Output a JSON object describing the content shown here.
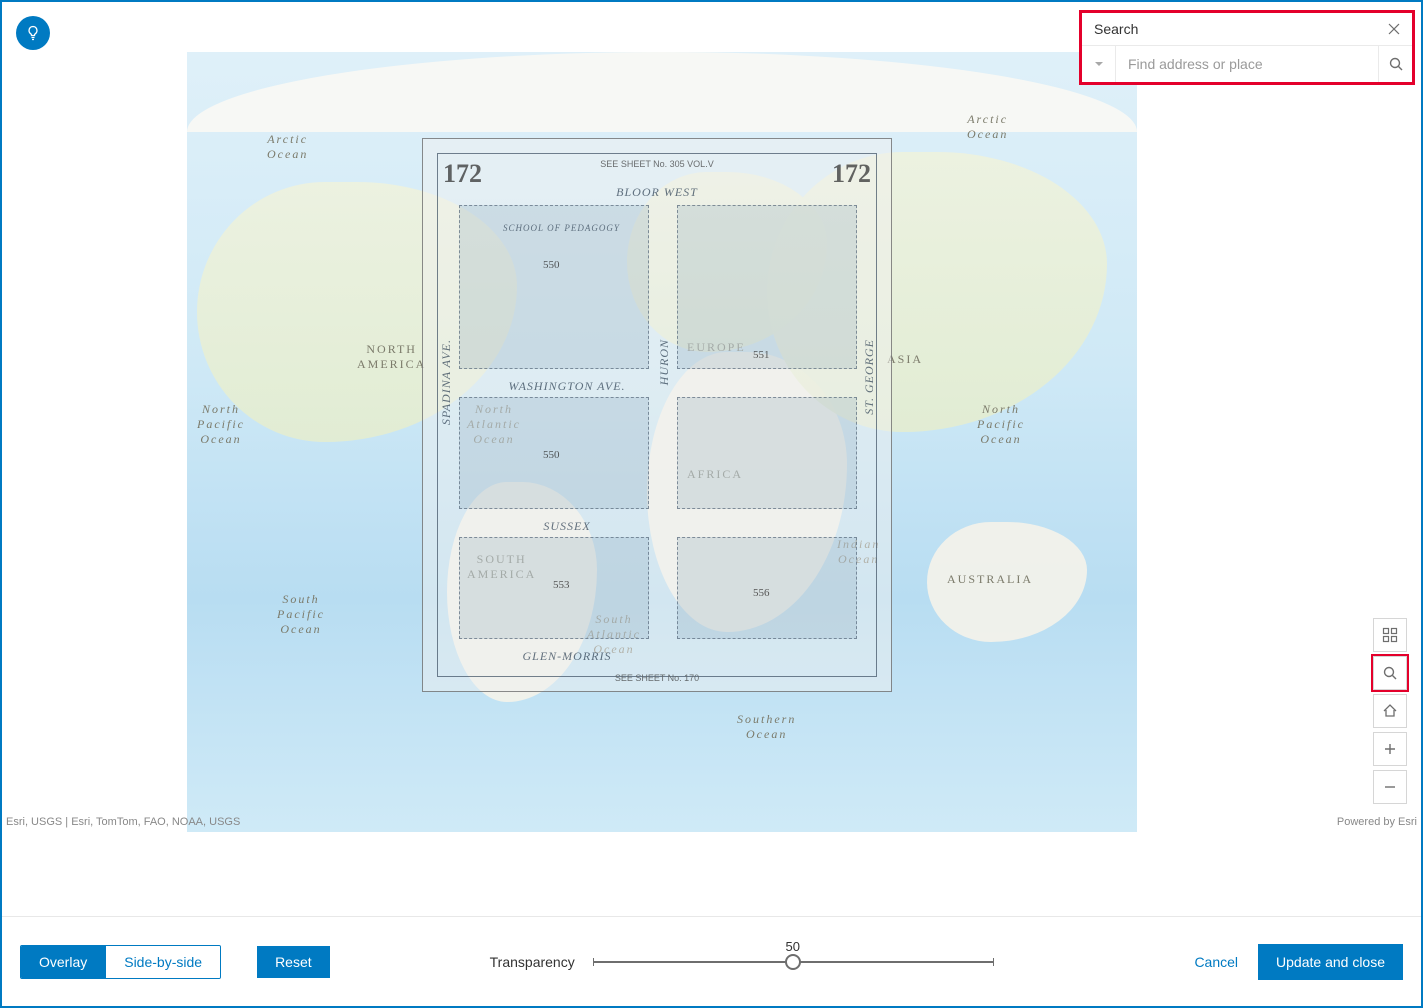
{
  "colors": {
    "accent": "#007ac2",
    "highlight": "#e4002b"
  },
  "search": {
    "title": "Search",
    "placeholder": "Find address or place",
    "value": ""
  },
  "map": {
    "attribution_left": "Esri, USGS | Esri, TomTom, FAO, NOAA, USGS",
    "attribution_right": "Powered by Esri",
    "labels": {
      "na": "NORTH\nAMERICA",
      "sa": "SOUTH\nAMERICA",
      "eu": "EUROPE",
      "af": "AFRICA",
      "as": "ASIA",
      "au": "AUSTRALIA",
      "arctic": "Arctic\nOcean",
      "arctic2": "Arctic\nOcean",
      "npac": "North\nPacific\nOcean",
      "spac": "South\nPacific\nOcean",
      "natl": "North\nAtlantic\nOcean",
      "satl": "South\nAtlantic\nOcean",
      "ind": "Indian\nOcean",
      "npac2": "North\nPacific\nOcean",
      "southern": "Southern\nOcean"
    }
  },
  "sheet": {
    "number": "172",
    "see_top": "SEE SHEET No. 305 VOL.V",
    "see_bottom": "SEE SHEET No. 170",
    "streets": {
      "bloor": "BLOOR        WEST",
      "washington": "WASHINGTON   AVE.",
      "sussex": "SUSSEX",
      "glen": "GLEN-MORRIS",
      "huron": "HURON",
      "spadina": "SPADINA   AVE.",
      "stgeorge": "ST. GEORGE"
    },
    "blocks": {
      "a": "550",
      "b": "551",
      "c": "550",
      "d": "553",
      "e": "556"
    },
    "banner": "SCHOOL OF PEDAGOGY"
  },
  "controls": {
    "basemap": "basemap-gallery",
    "search": "search",
    "home": "home",
    "zoom_in": "zoom-in",
    "zoom_out": "zoom-out"
  },
  "footer": {
    "overlay": "Overlay",
    "sidebyside": "Side-by-side",
    "reset": "Reset",
    "transparency_label": "Transparency",
    "transparency_value": "50",
    "cancel": "Cancel",
    "update": "Update and close"
  }
}
